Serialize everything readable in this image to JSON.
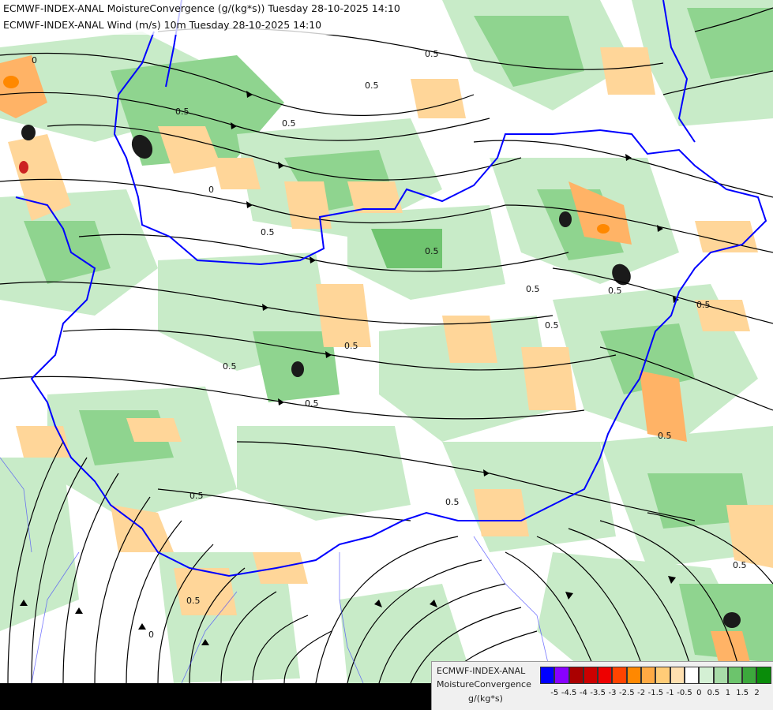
{
  "title": {
    "line1": "ECMWF-INDEX-ANAL MoistureConvergence (g/(kg*s)) Tuesday 28-10-2025 14:10",
    "line2": "ECMWF-INDEX-ANAL Wind (m/s) 10m Tuesday 28-10-2025 14:10"
  },
  "legend": {
    "line1": "ECMWF-INDEX-ANAL",
    "line2": "MoistureConvergence",
    "units": "g/(kg*s)",
    "colors": [
      "#0000ff",
      "#8800ff",
      "#aa0000",
      "#cc0000",
      "#ee0000",
      "#ff4400",
      "#ff8800",
      "#ffaa44",
      "#ffcc77",
      "#ffe0b0",
      "#ffffff",
      "#d4f0d4",
      "#a8dca8",
      "#6cc46c",
      "#3ca83c",
      "#0a8c0a"
    ],
    "ticks": [
      "-5",
      "-4.5",
      "-4",
      "-3.5",
      "-3",
      "-2.5",
      "-2",
      "-1.5",
      "-1",
      "-0.5",
      "0",
      "0.5",
      "1",
      "1.5",
      "2"
    ]
  },
  "map_labels": {
    "contour_values": [
      "0.5",
      "0",
      "0.5",
      "0.5",
      "0.5",
      "0",
      "0.5",
      "0.5",
      "0.5",
      "0.5",
      "0",
      "0.5",
      "0.5",
      "0.5",
      "0.5",
      "0.5",
      "0.5",
      "0.5",
      "0.5",
      "0.5",
      "0.5"
    ]
  },
  "colors": {
    "border": "#0000ff",
    "streamline": "#000000",
    "green_light": "#c8ebc8",
    "green_mid": "#8fd48f",
    "green_dark": "#3fa63f",
    "orange_light": "#ffd699",
    "orange_mid": "#ffb366",
    "peak_dark": "#1a1a1a",
    "peak_red": "#cc2222"
  }
}
